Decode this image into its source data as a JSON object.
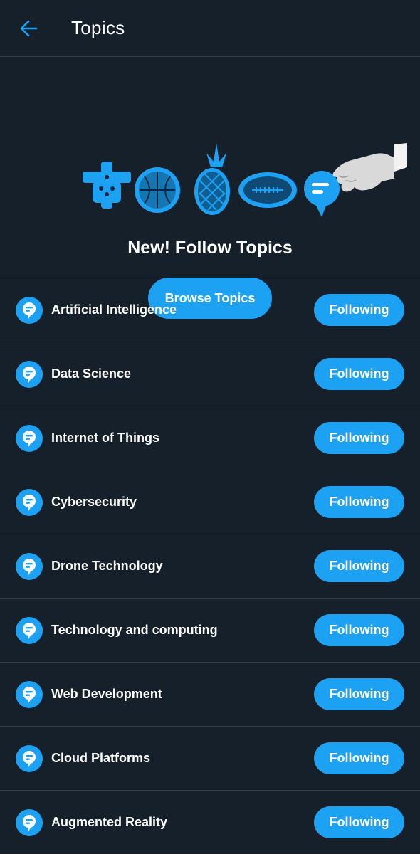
{
  "header": {
    "title": "Topics",
    "back_icon": "arrow-left-icon"
  },
  "hero": {
    "title": "New! Follow Topics",
    "browse_label": "Browse Topics",
    "art_icons": [
      "gamepad-icon",
      "basketball-icon",
      "pineapple-icon",
      "football-icon",
      "topic-bubble-icon",
      "hand-icon"
    ]
  },
  "topics": [
    {
      "label": "Artificial Intelligence",
      "button": "Following"
    },
    {
      "label": "Data Science",
      "button": "Following"
    },
    {
      "label": "Internet of Things",
      "button": "Following"
    },
    {
      "label": "Cybersecurity",
      "button": "Following"
    },
    {
      "label": "Drone Technology",
      "button": "Following"
    },
    {
      "label": "Technology and computing",
      "button": "Following"
    },
    {
      "label": "Web Development",
      "button": "Following"
    },
    {
      "label": "Cloud Platforms",
      "button": "Following"
    },
    {
      "label": "Augmented Reality",
      "button": "Following"
    }
  ],
  "colors": {
    "background": "#15202b",
    "accent": "#1da1f2",
    "divider": "#2f3d4b",
    "text": "#ffffff"
  }
}
